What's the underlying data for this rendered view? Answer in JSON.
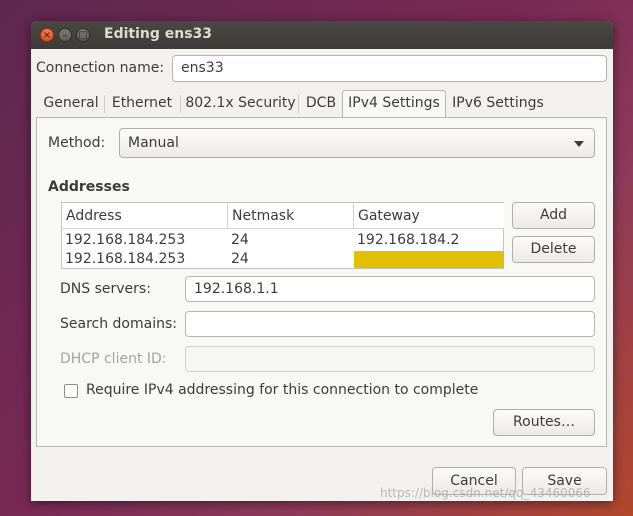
{
  "window": {
    "title": "Editing ens33",
    "controls": {
      "close": "×",
      "minimize": "–",
      "maximize": "□"
    }
  },
  "connection": {
    "label": "Connection name:",
    "value": "ens33"
  },
  "tabs": [
    {
      "label": "General"
    },
    {
      "label": "Ethernet"
    },
    {
      "label": "802.1x Security"
    },
    {
      "label": "DCB"
    },
    {
      "label": "IPv4 Settings",
      "active": true
    },
    {
      "label": "IPv6 Settings"
    }
  ],
  "ipv4": {
    "method_label": "Method:",
    "method_value": "Manual",
    "addresses_heading": "Addresses",
    "table": {
      "columns": [
        "Address",
        "Netmask",
        "Gateway"
      ],
      "rows": [
        [
          "192.168.184.253",
          "24",
          "192.168.184.2"
        ],
        [
          "192.168.184.253",
          "24",
          ""
        ]
      ]
    },
    "add_label": "Add",
    "delete_label": "Delete",
    "dns_label": "DNS servers:",
    "dns_value": "192.168.1.1",
    "search_label": "Search domains:",
    "search_value": "",
    "dhcp_label": "DHCP client ID:",
    "dhcp_value": "",
    "require_label": "Require IPv4 addressing for this connection to complete",
    "require_checked": false,
    "routes_label": "Routes…"
  },
  "footer": {
    "cancel_label": "Cancel",
    "save_label": "Save"
  },
  "watermark": "https://blog.csdn.net/qq_43460066",
  "colors": {
    "editing_cell": "#e0c000",
    "titlebar": "#3c3b37",
    "close_button": "#e95420"
  }
}
